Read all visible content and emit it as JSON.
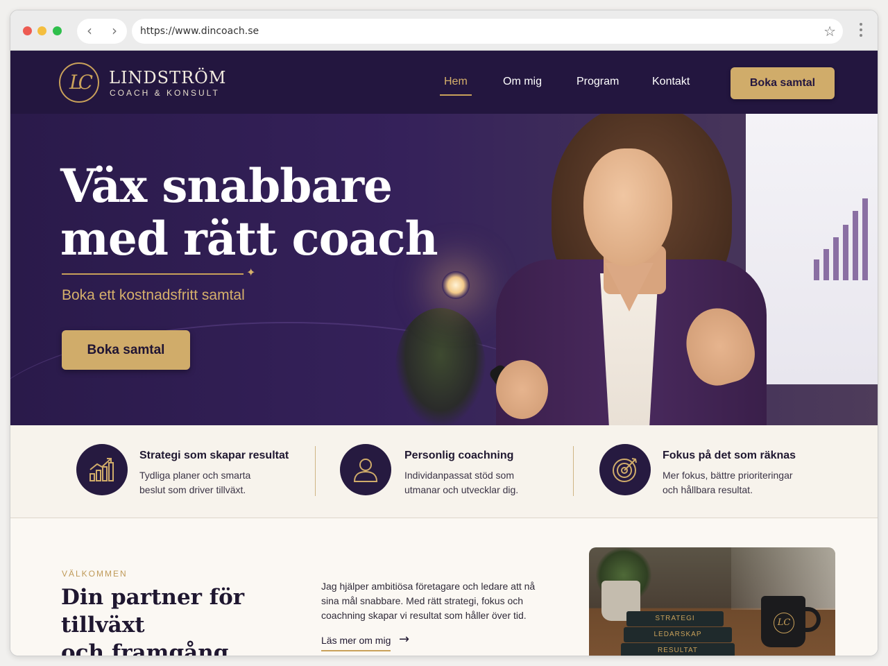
{
  "browser": {
    "url": "https://www.dincoach.se",
    "back_icon": "chevron-left-icon",
    "forward_icon": "chevron-right-icon",
    "bookmark_icon": "star-icon",
    "menu_icon": "kebab-menu-icon"
  },
  "header": {
    "logo_monogram": "LC",
    "brand_name": "LINDSTRÖM",
    "brand_tagline": "COACH & KONSULT",
    "nav": [
      {
        "label": "Hem",
        "active": true
      },
      {
        "label": "Om mig",
        "active": false
      },
      {
        "label": "Program",
        "active": false
      },
      {
        "label": "Kontakt",
        "active": false
      }
    ],
    "cta_label": "Boka samtal"
  },
  "hero": {
    "title_line1": "Väx snabbare",
    "title_line2": "med rätt coach",
    "subtitle": "Boka ett kostnadsfritt samtal",
    "cta_label": "Boka samtal"
  },
  "features": [
    {
      "icon": "growth-chart-icon",
      "title": "Strategi som skapar resultat",
      "desc_line1": "Tydliga planer och smarta",
      "desc_line2": "beslut som driver tillväxt."
    },
    {
      "icon": "person-icon",
      "title": "Personlig coachning",
      "desc_line1": "Individanpassat stöd som",
      "desc_line2": "utmanar och utvecklar dig."
    },
    {
      "icon": "target-icon",
      "title": "Fokus på det som räknas",
      "desc_line1": "Mer fokus, bättre prioriteringar",
      "desc_line2": "och hållbara resultat."
    }
  ],
  "welcome": {
    "eyebrow": "VÄLKOMMEN",
    "title_line1": "Din partner för tillväxt",
    "title_line2": "och framgång",
    "text_line1": "Jag hjälper ambitiösa företagare och ledare att nå",
    "text_line2": "sina mål snabbare. Med rätt strategi, fokus och",
    "text_line3": "coachning skapar vi resultat som håller över tid.",
    "link_label": "Läs mer om mig"
  },
  "photo": {
    "books": [
      "STRATEGI",
      "LEDARSKAP",
      "RESULTAT"
    ],
    "mug_monogram": "LC"
  },
  "colors": {
    "navy": "#23163f",
    "gold": "#d0ac6a",
    "cream": "#f7f3ec"
  }
}
